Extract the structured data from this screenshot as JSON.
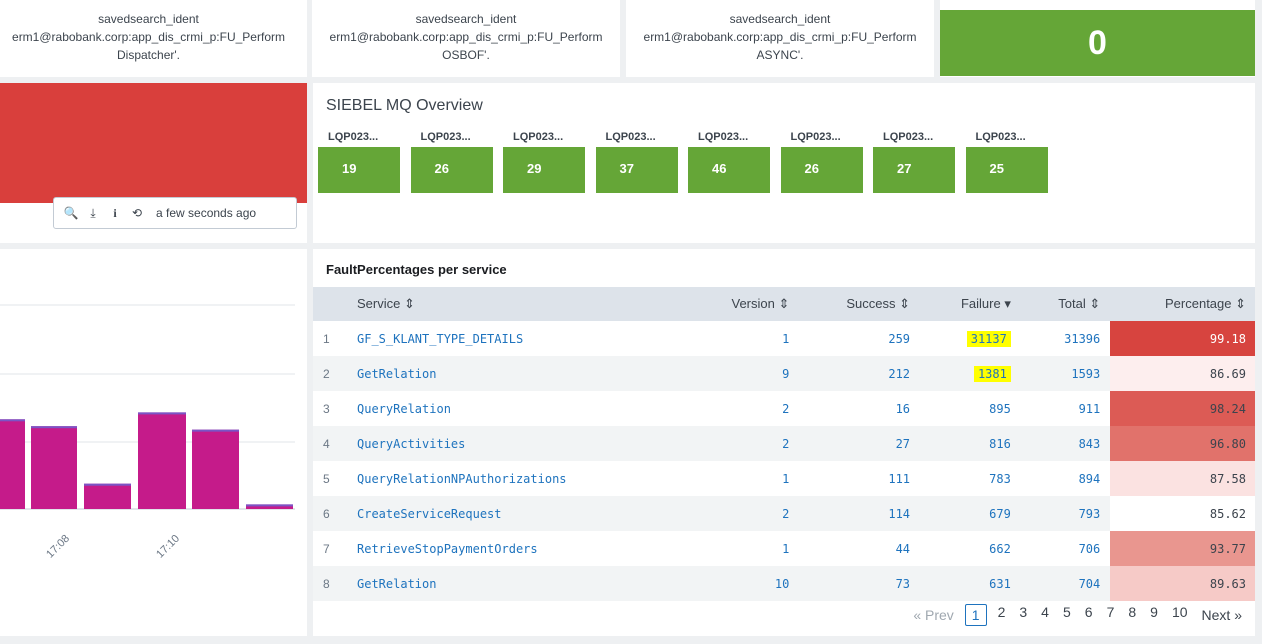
{
  "top_panels": [
    {
      "line1": "savedsearch_ident",
      "line2": "erm1@rabobank.corp:app_dis_crmi_p:FU_Perform",
      "line3": "Dispatcher'."
    },
    {
      "line1": "savedsearch_ident",
      "line2": "erm1@rabobank.corp:app_dis_crmi_p:FU_Perform",
      "line3": "OSBOF'."
    },
    {
      "line1": "savedsearch_ident",
      "line2": "erm1@rabobank.corp:app_dis_crmi_p:FU_Perform",
      "line3": "ASYNC'."
    }
  ],
  "single_value": {
    "value": "0",
    "color": "#65a637"
  },
  "red_panel": {
    "color": "#d93f3c"
  },
  "toolbar": {
    "search_icon": "search-icon",
    "export_icon": "download-icon",
    "inspect_icon": "info-icon",
    "refresh_icon": "refresh-icon",
    "timestamp": "a few seconds ago",
    "glyphs": {
      "search": "🔍",
      "export": "⤓",
      "info": "i",
      "refresh": "⟲"
    }
  },
  "mq_overview": {
    "title": "SIEBEL MQ Overview",
    "tiles": [
      {
        "label": "LQP023...",
        "value": "19"
      },
      {
        "label": "LQP023...",
        "value": "26"
      },
      {
        "label": "LQP023...",
        "value": "29"
      },
      {
        "label": "LQP023...",
        "value": "37"
      },
      {
        "label": "LQP023...",
        "value": "46"
      },
      {
        "label": "LQP023...",
        "value": "26"
      },
      {
        "label": "LQP023...",
        "value": "27"
      },
      {
        "label": "LQP023...",
        "value": "25"
      }
    ],
    "tile_color": "#65a637"
  },
  "chart_data": {
    "type": "bar",
    "x_tick_labels": [
      "17:08",
      "17:10"
    ],
    "values": [
      0.78,
      0.72,
      0.22,
      0.84,
      0.69,
      0.04
    ],
    "units": "fraction of visible plot height (y-axis not visible)",
    "bar_color": "#c51b8a",
    "cap_color": "#7a55c6",
    "grid": true
  },
  "fault_table": {
    "title": "FaultPercentages per service",
    "columns": {
      "service": "Service ⇕",
      "version": "Version ⇕",
      "success": "Success ⇕",
      "failure": "Failure ▾",
      "total": "Total ⇕",
      "percentage": "Percentage ⇕"
    },
    "rows": [
      {
        "idx": "1",
        "service": "GF_S_KLANT_TYPE_DETAILS",
        "version": "1",
        "success": "259",
        "failure": "31137",
        "total": "31396",
        "percentage": "99.18",
        "pct_bg": "#d7443f",
        "pct_fg": "#ffffff",
        "highlight": true
      },
      {
        "idx": "2",
        "service": "GetRelation",
        "version": "9",
        "success": "212",
        "failure": "1381",
        "total": "1593",
        "percentage": "86.69",
        "pct_bg": "#fdeeee",
        "pct_fg": "#3c444d",
        "highlight": true
      },
      {
        "idx": "3",
        "service": "QueryRelation",
        "version": "2",
        "success": "16",
        "failure": "895",
        "total": "911",
        "percentage": "98.24",
        "pct_bg": "#dc5b55",
        "pct_fg": "#3c444d",
        "highlight": false
      },
      {
        "idx": "4",
        "service": "QueryActivities",
        "version": "2",
        "success": "27",
        "failure": "816",
        "total": "843",
        "percentage": "96.80",
        "pct_bg": "#e1726b",
        "pct_fg": "#3c444d",
        "highlight": false
      },
      {
        "idx": "5",
        "service": "QueryRelationNPAuthorizations",
        "version": "1",
        "success": "111",
        "failure": "783",
        "total": "894",
        "percentage": "87.58",
        "pct_bg": "#fbe2e1",
        "pct_fg": "#3c444d",
        "highlight": false
      },
      {
        "idx": "6",
        "service": "CreateServiceRequest",
        "version": "2",
        "success": "114",
        "failure": "679",
        "total": "793",
        "percentage": "85.62",
        "pct_bg": "#ffffff",
        "pct_fg": "#3c444d",
        "highlight": false
      },
      {
        "idx": "7",
        "service": "RetrieveStopPaymentOrders",
        "version": "1",
        "success": "44",
        "failure": "662",
        "total": "706",
        "percentage": "93.77",
        "pct_bg": "#e9968f",
        "pct_fg": "#3c444d",
        "highlight": false
      },
      {
        "idx": "8",
        "service": "GetRelation",
        "version": "10",
        "success": "73",
        "failure": "631",
        "total": "704",
        "percentage": "89.63",
        "pct_bg": "#f6cac7",
        "pct_fg": "#3c444d",
        "highlight": false
      }
    ]
  },
  "pagination": {
    "prev": "« Prev",
    "pages": [
      "1",
      "2",
      "3",
      "4",
      "5",
      "6",
      "7",
      "8",
      "9",
      "10"
    ],
    "current": "1",
    "next": "Next »"
  }
}
